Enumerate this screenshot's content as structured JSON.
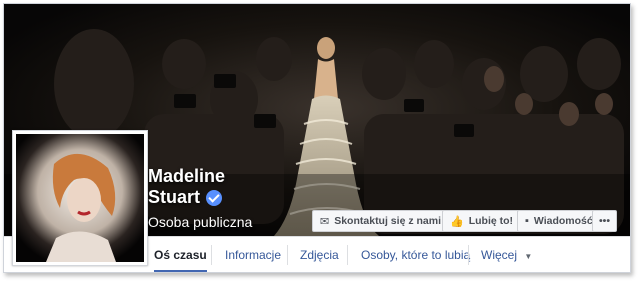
{
  "profile": {
    "name_line1": "Madeline",
    "name_line2": "Stuart",
    "category": "Osoba publiczna",
    "verified_icon": "verified-badge-icon"
  },
  "actions": {
    "contact": "Skontaktuj się z nami",
    "like": "Lubię to!",
    "message": "Wiadomość",
    "more": "•••"
  },
  "tabs": [
    {
      "label": "Oś czasu",
      "active": true
    },
    {
      "label": "Informacje"
    },
    {
      "label": "Zdjęcia"
    },
    {
      "label": "Osoby, które to lubią"
    },
    {
      "label": "Więcej"
    }
  ],
  "colors": {
    "accent": "#4267b2",
    "link": "#365899",
    "verified": "#5890ff"
  }
}
